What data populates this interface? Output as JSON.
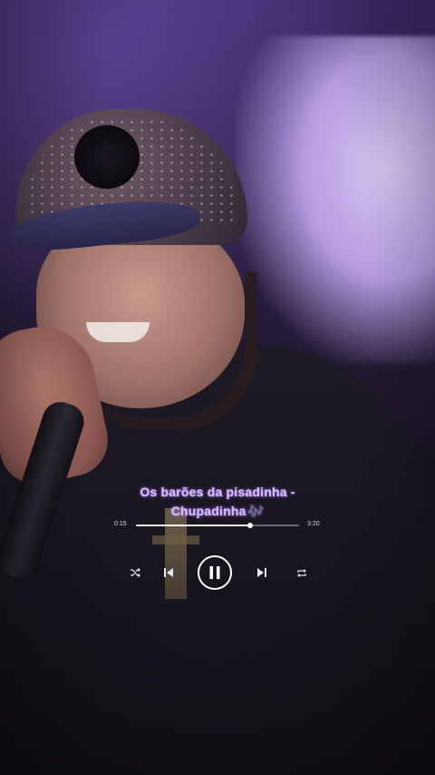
{
  "video": {
    "description_icon": "performer-video-frame"
  },
  "music_player": {
    "title_line1": "Os barões da pisadinha -",
    "title_line2": "Chupadinha",
    "note_glyph": "🎶",
    "elapsed": "0:15",
    "duration": "3:20",
    "progress": 0.7,
    "state": "playing",
    "icons": {
      "shuffle": "shuffle-icon",
      "previous": "skip-previous-icon",
      "play_pause": "pause-icon",
      "next": "skip-next-icon",
      "repeat": "repeat-icon"
    },
    "accent_color": "#d6b8ff"
  }
}
